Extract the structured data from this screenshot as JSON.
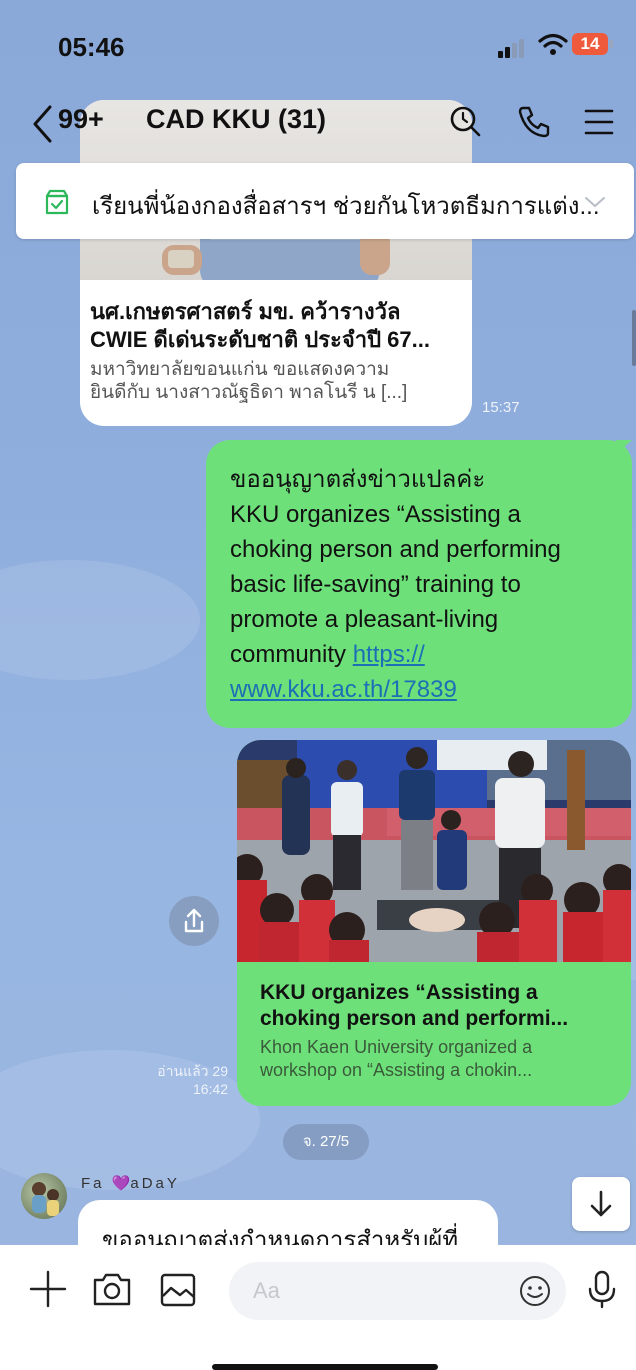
{
  "status_bar": {
    "time": "05:46",
    "battery": "14"
  },
  "header": {
    "unread_count": "99+",
    "title": "CAD KKU (31)"
  },
  "announcement": {
    "text": "เรียนพี่น้องกองสื่อสารฯ ช่วยกันโหวตธีมการแต่ง..."
  },
  "link_card_1": {
    "title_line1": "นศ.เกษตรศาสตร์ มข. คว้ารางวัล",
    "title_line2": "CWIE ดีเด่นระดับชาติ ประจำปี 67...",
    "desc_line1": "มหาวิทยาลัยขอนแก่น ขอแสดงความ",
    "desc_line2": "ยินดีกับ นางสาวณัฐธิดา พาลโนรี น [...]",
    "time": "15:37"
  },
  "message_1": {
    "line1": "ขออนุญาตส่งข่าวแปลค่ะ",
    "line2": "KKU organizes “Assisting a",
    "line3": "choking person and performing",
    "line4": "basic life-saving” training to",
    "line5": "promote a pleasant-living",
    "line6_text": "community ",
    "link_part1": "https://",
    "link_part2": "www.kku.ac.th/17839"
  },
  "link_card_2": {
    "title_line1": "KKU organizes “Assisting a",
    "title_line2": "choking person and performi...",
    "desc_line1": "Khon Kaen University organized a",
    "desc_line2": "workshop on “Assisting a chokin..."
  },
  "read_receipt": {
    "read": "อ่านแล้ว 29",
    "time": "16:42"
  },
  "date_divider": "จ. 27/5",
  "incoming": {
    "sender_pre": "Fa ",
    "sender_heart": "💜",
    "sender_post": "aDaY",
    "text": "ขออนุญาตส่งกำหนดการสำหรับผู้ที่"
  },
  "input": {
    "placeholder": "Aa"
  },
  "colors": {
    "chat_bg": "#8aa8d8",
    "my_bubble": "#6ee07a",
    "link": "#1c6fb5",
    "battery": "#f05a3c"
  }
}
